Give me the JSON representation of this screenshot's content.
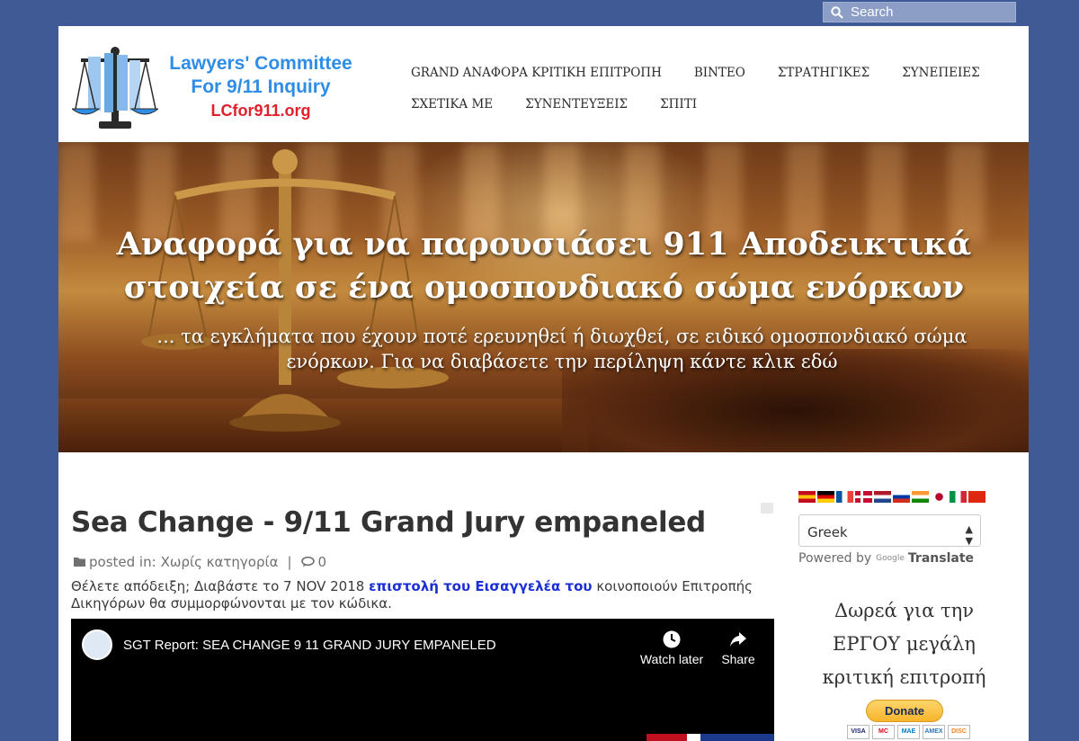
{
  "search": {
    "label": "Search"
  },
  "logo": {
    "title": "Lawyers' Committee For 9/11 Inquiry",
    "url": "LCfor911.org"
  },
  "nav": {
    "row1": [
      "GRAND ΑΝΑΦΟΡΑ ΚΡΙΤΙΚΗ ΕΠΙΤΡΟΠΗ",
      "ΒΙΝΤΕΟ",
      "ΣΤΡΑΤΗΓΙΚΕΣ",
      "ΣΥΝΕΠΕΙΕΣ"
    ],
    "row2": [
      "ΣΧΕΤΙΚΑ ΜΕ",
      "ΣΥΝΕΝΤΕΥΞΕΙΣ",
      "ΣΠΙΤΙ"
    ]
  },
  "banner": {
    "headline": "Αναφορά για να παρουσιάσει 911 Αποδεικτικά στοιχεία σε ένα ομοσπονδιακό σώμα ενόρκων",
    "subline": "... τα εγκλήματα που έχουν ποτέ ερευνηθεί ή διωχθεί, σε ειδικό ομοσπονδιακό σώμα ενόρκων. Για να διαβάσετε την περίληψη κάντε κλικ εδώ"
  },
  "post": {
    "title": "Sea Change - 9/11 Grand Jury empaneled",
    "posted_in_label": "posted in:",
    "category": "Χωρίς κατηγορία",
    "comments": "0",
    "body_before": "Θέλετε απόδειξη; Διαβάστε το 7 NOV 2018 ",
    "body_link": "επιστολή του Εισαγγελέα του",
    "body_after": " κοινοποιούν Επιτροπής Δικηγόρων θα συμμορφώνονται με τον κώδικα."
  },
  "video": {
    "title": "SGT Report: SEA CHANGE 9 11 GRAND JURY EMPANELED",
    "watch_later": "Watch later",
    "share": "Share"
  },
  "sidebar": {
    "language": "Greek",
    "powered_by": "Powered by",
    "google": "Google",
    "translate": "Translate",
    "donate_text": "Δωρεά για την ΕΡΓΟΥ μεγάλη κριτική επιτροπή",
    "donate_button": "Donate",
    "flags": [
      {
        "name": "spain-flag",
        "colors": [
          "#c60b1e",
          "#ffc400",
          "#c60b1e"
        ]
      },
      {
        "name": "germany-flag",
        "colors": [
          "#000000",
          "#dd0000",
          "#ffce00"
        ]
      },
      {
        "name": "france-flag",
        "colors": [
          "#0055a4",
          "#ffffff",
          "#ef4135"
        ]
      },
      {
        "name": "denmark-flag",
        "colors": [
          "#c60c30",
          "#ffffff",
          "#c60c30"
        ]
      },
      {
        "name": "netherlands-flag",
        "colors": [
          "#ae1c28",
          "#ffffff",
          "#21468b"
        ]
      },
      {
        "name": "russia-flag",
        "colors": [
          "#ffffff",
          "#0039a6",
          "#d52b1e"
        ]
      },
      {
        "name": "india-flag",
        "colors": [
          "#ff9933",
          "#ffffff",
          "#138808"
        ]
      },
      {
        "name": "japan-flag",
        "colors": [
          "#ffffff",
          "#bc002d",
          "#ffffff"
        ]
      },
      {
        "name": "italy-flag",
        "colors": [
          "#009246",
          "#ffffff",
          "#ce2b37"
        ]
      },
      {
        "name": "china-flag",
        "colors": [
          "#de2910",
          "#de2910",
          "#de2910"
        ]
      }
    ],
    "cards": [
      "VISA",
      "MC",
      "MAE",
      "AMEX",
      "DISC"
    ]
  }
}
